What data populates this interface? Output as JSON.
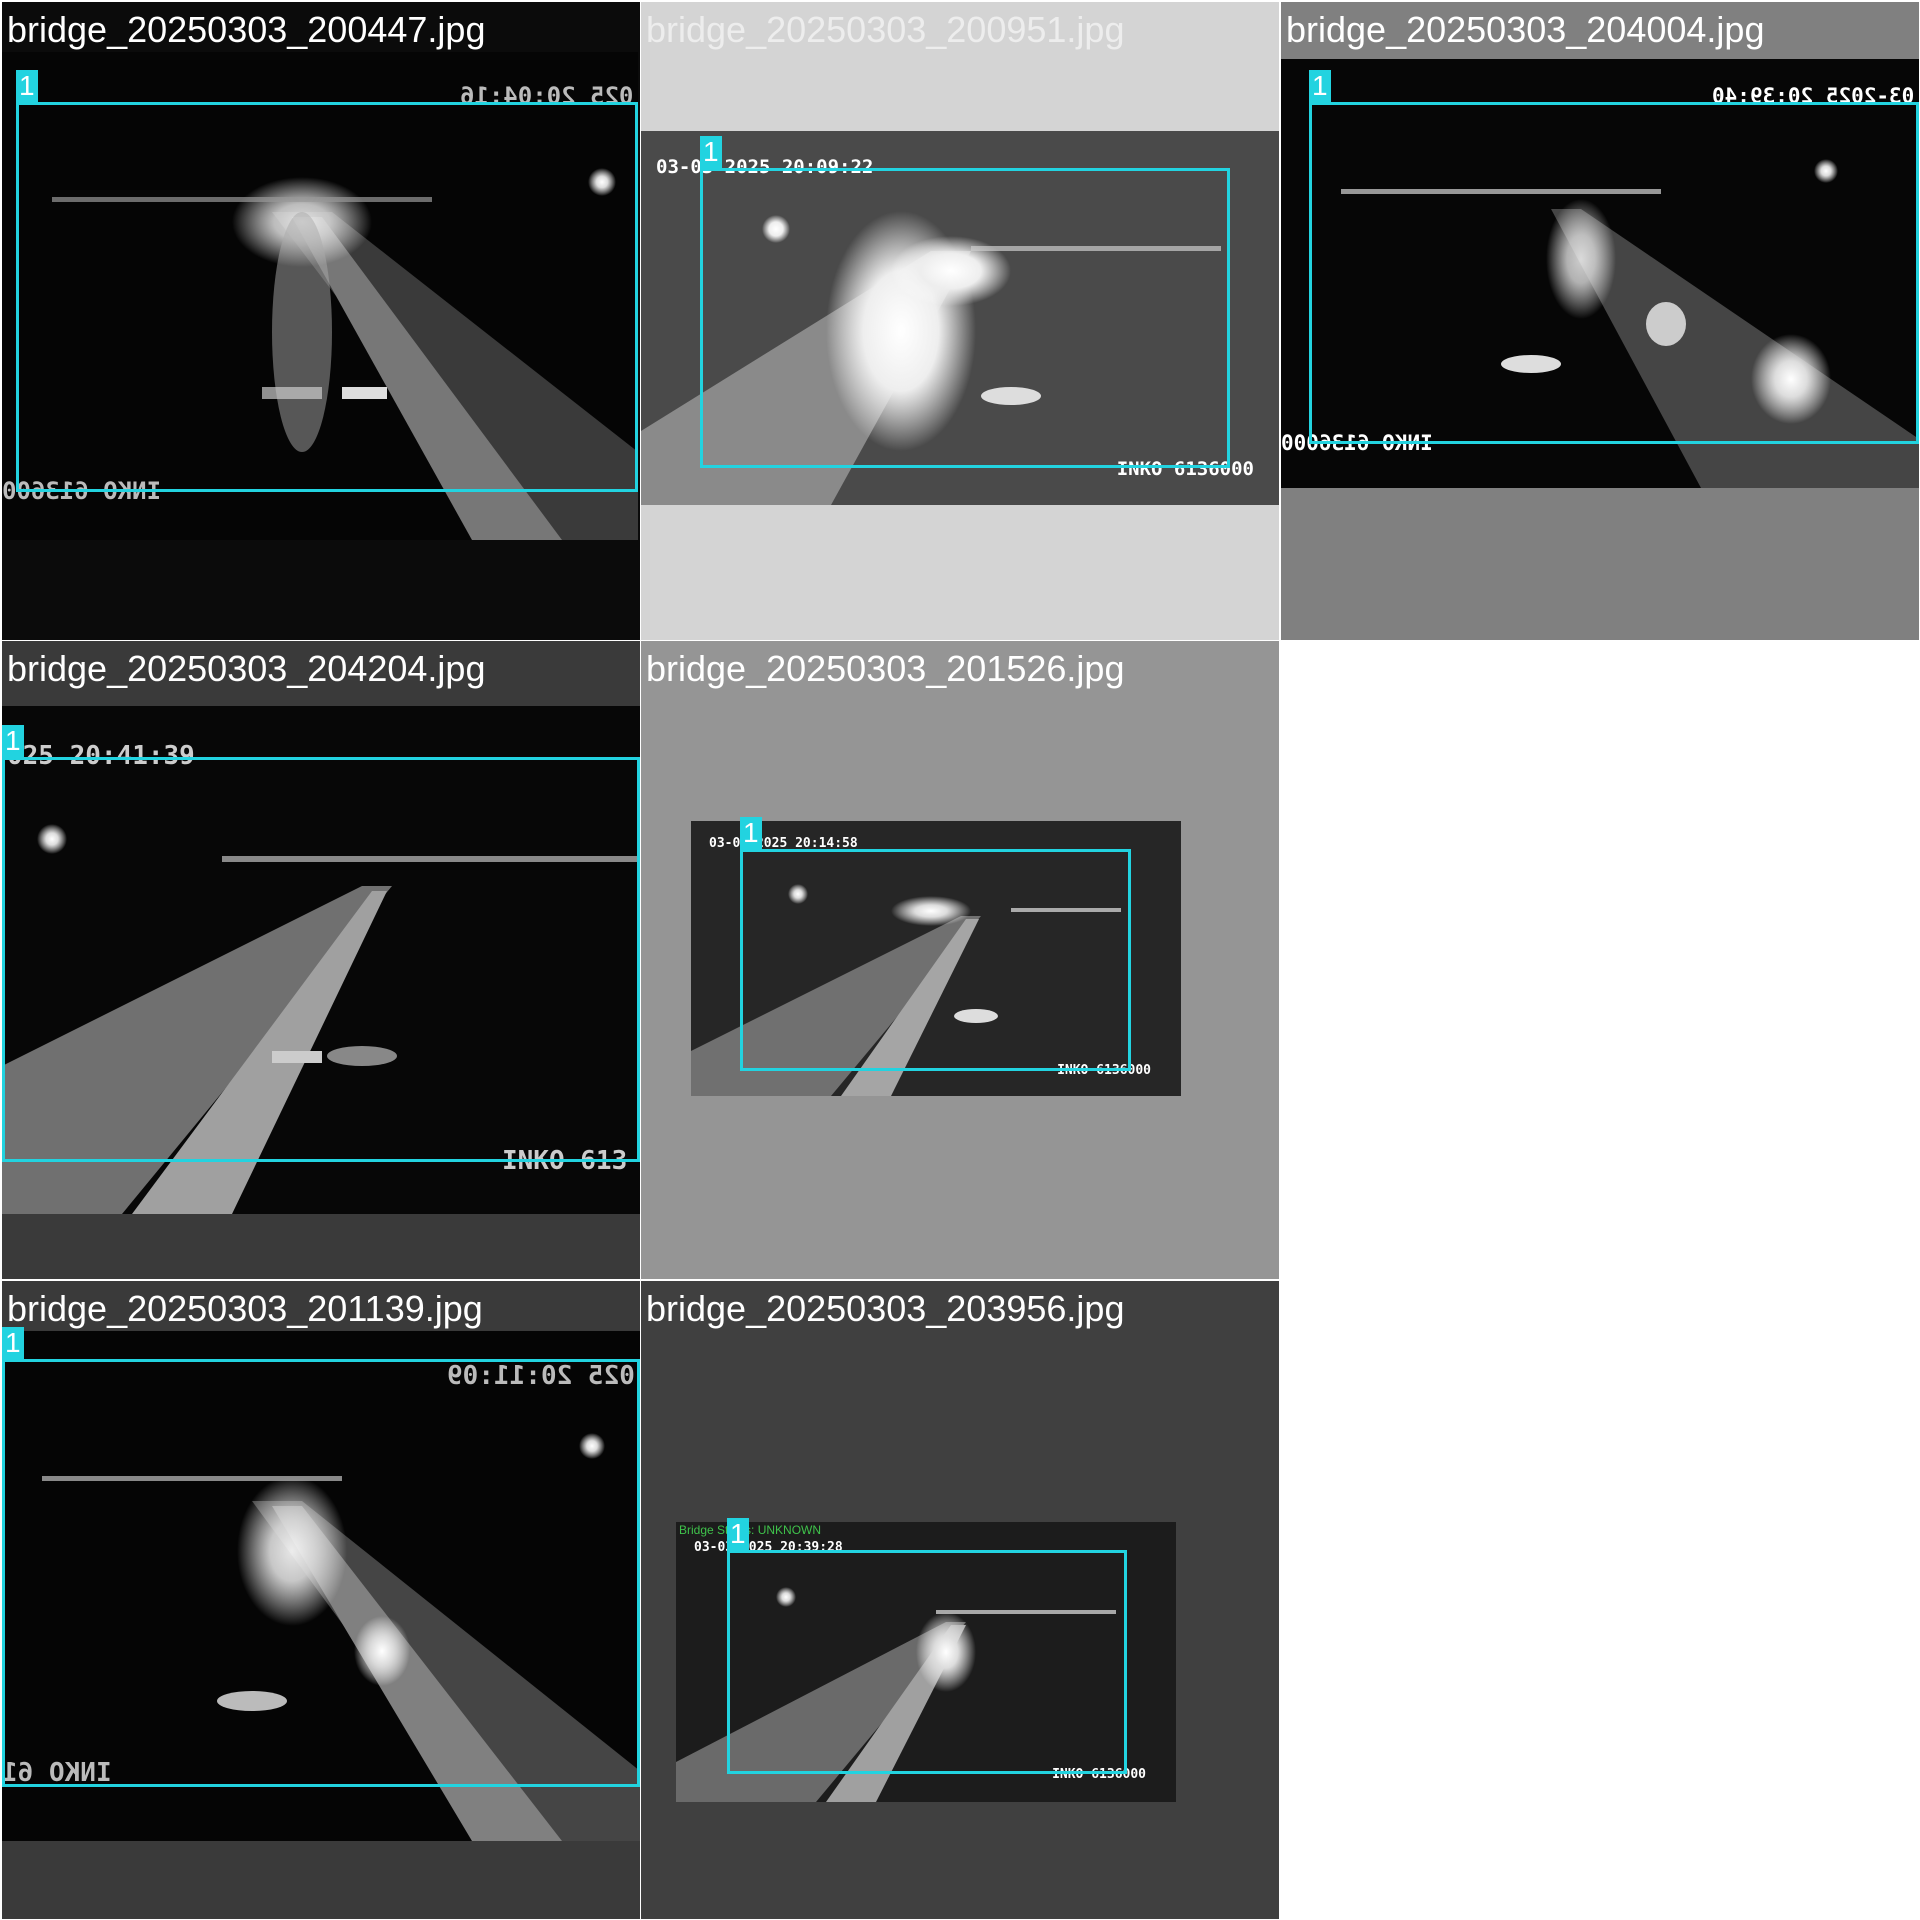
{
  "tiles": [
    {
      "filename": "bridge_20250303_200447.jpg",
      "timestamp": "025 20:04:16",
      "camera_id": "INKO 613600",
      "box_label": "1"
    },
    {
      "filename": "bridge_20250303_200951.jpg",
      "timestamp": "03-03-2025 20:09:22",
      "camera_id": "INKO 6136000",
      "box_label": "1"
    },
    {
      "filename": "bridge_20250303_204004.jpg",
      "timestamp": "03-2025 20:39:40",
      "camera_id": "INKO 6136000",
      "box_label": "1"
    },
    {
      "filename": "bridge_20250303_204204.jpg",
      "timestamp": "025 20:41:39",
      "camera_id": "INKO 613",
      "box_label": "1"
    },
    {
      "filename": "bridge_20250303_201526.jpg",
      "timestamp": "03-03-2025 20:14:58",
      "camera_id": "INKO 6136000",
      "box_label": "1"
    },
    {
      "filename": "bridge_20250303_201139.jpg",
      "timestamp": "025 20:11:09",
      "camera_id": "INKO 61",
      "box_label": "1"
    },
    {
      "filename": "bridge_20250303_203956.jpg",
      "timestamp": "03-03-2025 20:39:28",
      "camera_id": "INKO 6136000",
      "box_label": "1",
      "status_text": "Bridge Status: UNKNOWN"
    }
  ],
  "colors": {
    "box": "#22d3e0",
    "status": "#3fc24b"
  }
}
